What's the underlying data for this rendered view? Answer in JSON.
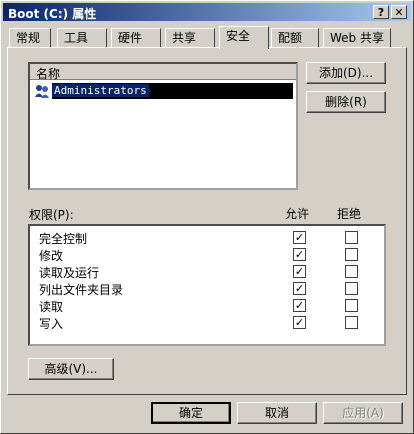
{
  "window": {
    "title": "Boot (C:) 属性",
    "help_button": "?",
    "close_button": "✕"
  },
  "tabs": [
    {
      "label": "常规"
    },
    {
      "label": "工具"
    },
    {
      "label": "硬件"
    },
    {
      "label": "共享"
    },
    {
      "label": "安全",
      "active": true
    },
    {
      "label": "配额"
    },
    {
      "label": "Web 共享"
    }
  ],
  "users": {
    "column_header": "名称",
    "items": [
      {
        "name": "Administrators",
        "selected": true
      }
    ],
    "add_button": "添加(D)...",
    "remove_button": "删除(R)"
  },
  "permissions": {
    "label": "权限(P):",
    "allow_header": "允许",
    "deny_header": "拒绝",
    "rows": [
      {
        "name": "完全控制",
        "allow": true,
        "deny": false
      },
      {
        "name": "修改",
        "allow": true,
        "deny": false
      },
      {
        "name": "读取及运行",
        "allow": true,
        "deny": false
      },
      {
        "name": "列出文件夹目录",
        "allow": true,
        "deny": false
      },
      {
        "name": "读取",
        "allow": true,
        "deny": false
      },
      {
        "name": "写入",
        "allow": true,
        "deny": false
      }
    ]
  },
  "advanced_button": "高级(V)...",
  "footer": {
    "ok": "确定",
    "cancel": "取消",
    "apply": "应用(A)"
  },
  "check_mark": "✓"
}
